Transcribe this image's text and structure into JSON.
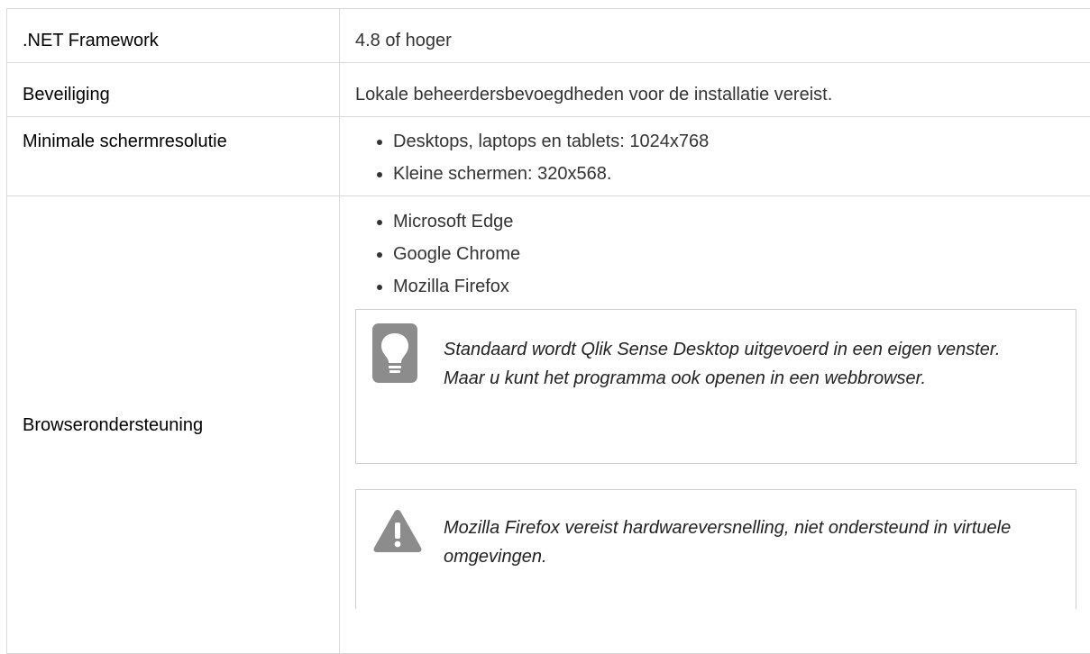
{
  "rows": [
    {
      "label": ".NET Framework",
      "value": "4.8 of hoger"
    },
    {
      "label": "Beveiliging",
      "value": "Lokale beheerdersbevoegdheden voor de installatie vereist."
    },
    {
      "label": "Minimale schermresolutie",
      "items": [
        "Desktops, laptops en tablets: 1024x768",
        "Kleine schermen: 320x568."
      ]
    },
    {
      "label": "Browserondersteuning",
      "items": [
        "Microsoft Edge",
        "Google Chrome",
        "Mozilla Firefox"
      ]
    }
  ],
  "notes": {
    "tip": {
      "icon": "lightbulb-icon",
      "text": "Standaard wordt Qlik Sense Desktop uitgevoerd in een eigen venster. Maar u kunt het programma ook openen in een webbrowser."
    },
    "warning": {
      "icon": "warning-icon",
      "text": "Mozilla Firefox vereist hardwareversnelling, niet ondersteund in virtuele omgevingen."
    }
  },
  "colors": {
    "icon_gray": "#8c8c8c",
    "border": "#d9d9d9"
  }
}
